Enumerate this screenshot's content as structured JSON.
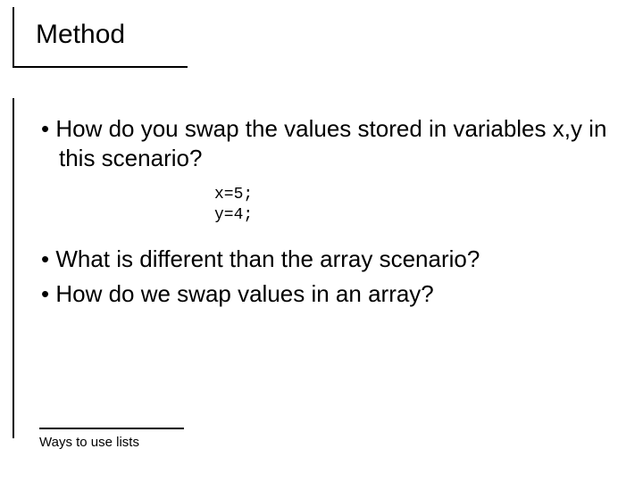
{
  "title": "Method",
  "bullets": {
    "b1": "How do you swap the values stored in variables x,y in this scenario?",
    "b2": "What is different than the array scenario?",
    "b3": "How do we swap values in an array?"
  },
  "code": "x=5;\ny=4;",
  "footer": "Ways to use lists"
}
